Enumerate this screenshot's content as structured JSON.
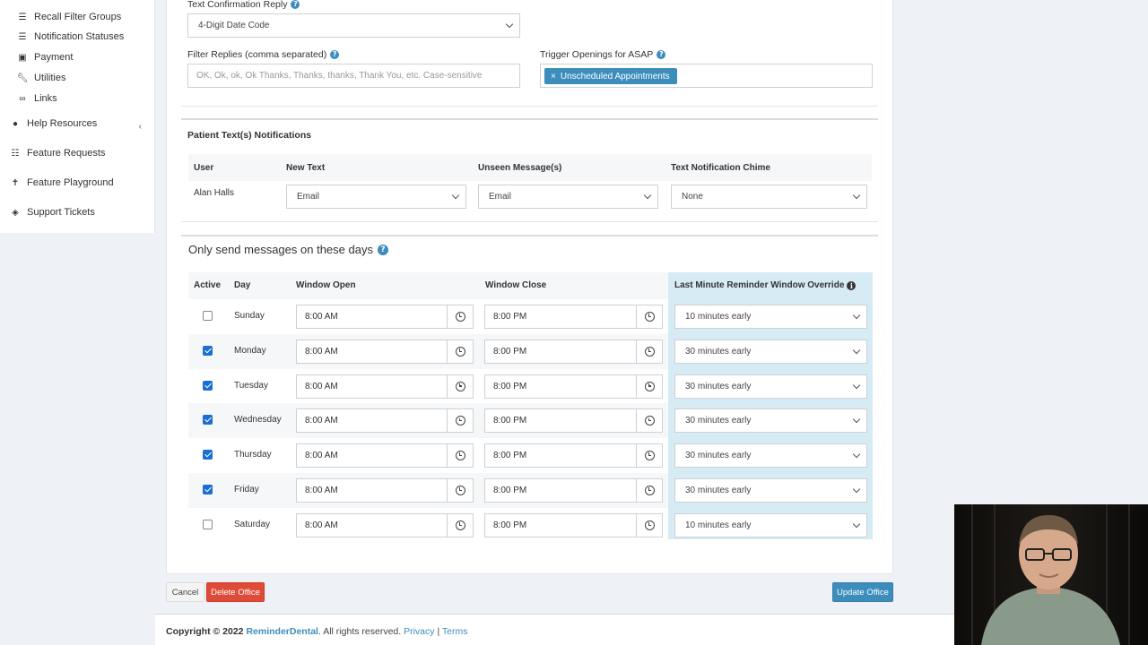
{
  "sidebar": {
    "items": [
      {
        "label": "Recall Filter Groups",
        "icon": "list-icon"
      },
      {
        "label": "Notification Statuses",
        "icon": "list-icon"
      },
      {
        "label": "Payment",
        "icon": "money-icon"
      },
      {
        "label": "Utilities",
        "icon": "wrench-icon"
      },
      {
        "label": "Links",
        "icon": "link-icon"
      }
    ],
    "top_items": [
      {
        "label": "Help Resources",
        "icon": "info-circle-icon"
      },
      {
        "label": "Feature Requests",
        "icon": "list-ul-icon"
      },
      {
        "label": "Feature Playground",
        "icon": "child-icon"
      },
      {
        "label": "Support Tickets",
        "icon": "ticket-icon"
      }
    ]
  },
  "form": {
    "text_confirmation_label": "Text Confirmation Reply",
    "text_confirmation_value": "4-Digit Date Code",
    "filter_replies_label": "Filter Replies (comma separated)",
    "filter_replies_placeholder": "OK, Ok, ok, Ok Thanks, Thanks, thanks, Thank You, etc. Case-sensitive",
    "trigger_label": "Trigger Openings for ASAP",
    "trigger_tag": "Unscheduled Appointments"
  },
  "notifications": {
    "title": "Patient Text(s) Notifications",
    "headers": [
      "User",
      "New Text",
      "Unseen Message(s)",
      "Text Notification Chime"
    ],
    "row": {
      "user": "Alan Halls",
      "new_text": "Email",
      "unseen": "Email",
      "chime": "None"
    }
  },
  "days": {
    "title": "Only send messages on these days",
    "headers": {
      "active": "Active",
      "day": "Day",
      "open": "Window Open",
      "close": "Window Close",
      "override": "Last Minute Reminder Window Override"
    },
    "rows": [
      {
        "active": false,
        "day": "Sunday",
        "open": "8:00 AM",
        "close": "8:00 PM",
        "override": "10 minutes early"
      },
      {
        "active": true,
        "day": "Monday",
        "open": "8:00 AM",
        "close": "8:00 PM",
        "override": "30 minutes early"
      },
      {
        "active": true,
        "day": "Tuesday",
        "open": "8:00 AM",
        "close": "8:00 PM",
        "override": "30 minutes early"
      },
      {
        "active": true,
        "day": "Wednesday",
        "open": "8:00 AM",
        "close": "8:00 PM",
        "override": "30 minutes early"
      },
      {
        "active": true,
        "day": "Thursday",
        "open": "8:00 AM",
        "close": "8:00 PM",
        "override": "30 minutes early"
      },
      {
        "active": true,
        "day": "Friday",
        "open": "8:00 AM",
        "close": "8:00 PM",
        "override": "30 minutes early"
      },
      {
        "active": false,
        "day": "Saturday",
        "open": "8:00 AM",
        "close": "8:00 PM",
        "override": "10 minutes early"
      }
    ]
  },
  "actions": {
    "cancel": "Cancel",
    "delete": "Delete Office",
    "update": "Update Office"
  },
  "footer": {
    "copyright": "Copyright © 2022",
    "brand": "ReminderDental",
    "rights": ". All rights reserved.",
    "privacy": "Privacy",
    "separator": "|",
    "terms": "Terms"
  },
  "colors": {
    "accent": "#3c8dbc",
    "danger": "#dd4b39",
    "override_bg": "#d7ebf4"
  }
}
